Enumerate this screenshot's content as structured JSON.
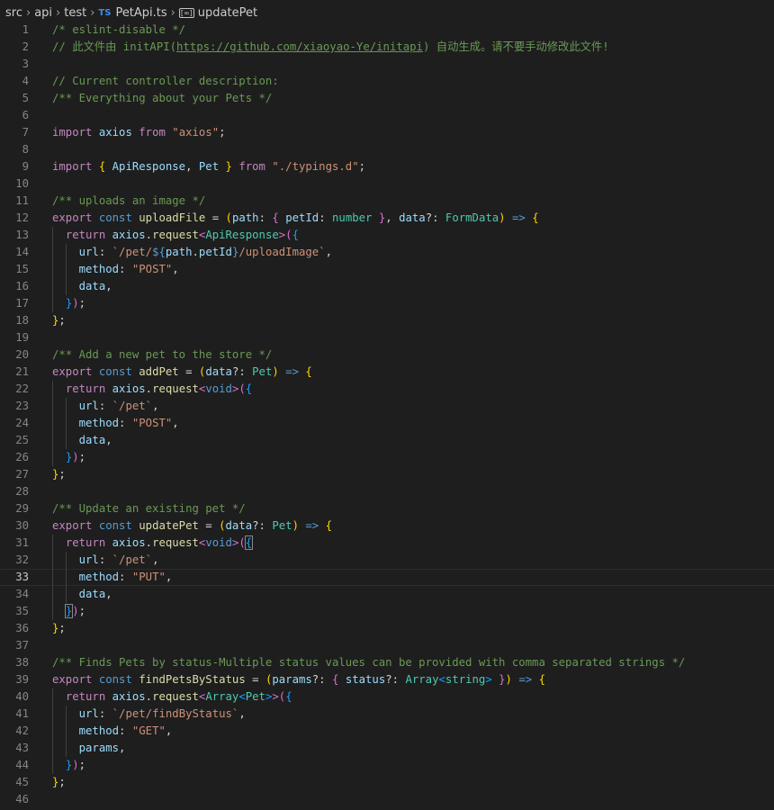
{
  "breadcrumb": {
    "items": [
      "src",
      "api",
      "test"
    ],
    "file_badge": "TS",
    "file": "PetApi.ts",
    "symbol": "updatePet"
  },
  "editor": {
    "active_line": 33,
    "lines": [
      {
        "n": 1,
        "tokens": [
          [
            "c",
            "/* eslint-disable */"
          ]
        ]
      },
      {
        "n": 2,
        "tokens": [
          [
            "c",
            "// 此文件由 initAPI("
          ],
          [
            "c u",
            "https://github.com/xiaoyao-Ye/initapi"
          ],
          [
            "c",
            ") 自动生成。请不要手动修改此文件!"
          ]
        ]
      },
      {
        "n": 3,
        "tokens": []
      },
      {
        "n": 4,
        "tokens": [
          [
            "c",
            "// Current controller description:"
          ]
        ]
      },
      {
        "n": 5,
        "tokens": [
          [
            "c",
            "/** Everything about your Pets */"
          ]
        ]
      },
      {
        "n": 6,
        "tokens": []
      },
      {
        "n": 7,
        "tokens": [
          [
            "kc",
            "import"
          ],
          [
            "p",
            " "
          ],
          [
            "v",
            "axios"
          ],
          [
            "p",
            " "
          ],
          [
            "kc",
            "from"
          ],
          [
            "p",
            " "
          ],
          [
            "s",
            "\"axios\""
          ],
          [
            "p",
            ";"
          ]
        ]
      },
      {
        "n": 8,
        "tokens": []
      },
      {
        "n": 9,
        "tokens": [
          [
            "kc",
            "import"
          ],
          [
            "p",
            " "
          ],
          [
            "b1",
            "{"
          ],
          [
            "p",
            " "
          ],
          [
            "v",
            "ApiResponse"
          ],
          [
            "p",
            ", "
          ],
          [
            "v",
            "Pet"
          ],
          [
            "p",
            " "
          ],
          [
            "b1",
            "}"
          ],
          [
            "p",
            " "
          ],
          [
            "kc",
            "from"
          ],
          [
            "p",
            " "
          ],
          [
            "s",
            "\"./typings.d\""
          ],
          [
            "p",
            ";"
          ]
        ]
      },
      {
        "n": 10,
        "tokens": []
      },
      {
        "n": 11,
        "tokens": [
          [
            "c",
            "/** uploads an image */"
          ]
        ]
      },
      {
        "n": 12,
        "tokens": [
          [
            "kc",
            "export"
          ],
          [
            "p",
            " "
          ],
          [
            "k",
            "const"
          ],
          [
            "p",
            " "
          ],
          [
            "f",
            "uploadFile"
          ],
          [
            "p",
            " = "
          ],
          [
            "b1",
            "("
          ],
          [
            "v",
            "path"
          ],
          [
            "p",
            ": "
          ],
          [
            "b2",
            "{"
          ],
          [
            "p",
            " "
          ],
          [
            "v",
            "petId"
          ],
          [
            "p",
            ": "
          ],
          [
            "t",
            "number"
          ],
          [
            "p",
            " "
          ],
          [
            "b2",
            "}"
          ],
          [
            "p",
            ", "
          ],
          [
            "v",
            "data"
          ],
          [
            "p",
            "?: "
          ],
          [
            "t",
            "FormData"
          ],
          [
            "b1",
            ")"
          ],
          [
            "p",
            " "
          ],
          [
            "k",
            "=>"
          ],
          [
            "p",
            " "
          ],
          [
            "b1",
            "{"
          ]
        ]
      },
      {
        "n": 13,
        "tokens": [
          [
            "p",
            "  "
          ],
          [
            "kc",
            "return"
          ],
          [
            "p",
            " "
          ],
          [
            "v",
            "axios"
          ],
          [
            "p",
            "."
          ],
          [
            "f",
            "request"
          ],
          [
            "b2",
            "<"
          ],
          [
            "t",
            "ApiResponse"
          ],
          [
            "b2",
            ">("
          ],
          [
            "b3",
            "{"
          ]
        ]
      },
      {
        "n": 14,
        "tokens": [
          [
            "p",
            "    "
          ],
          [
            "v",
            "url"
          ],
          [
            "p",
            ": "
          ],
          [
            "s",
            "`/pet/"
          ],
          [
            "k",
            "${"
          ],
          [
            "v",
            "path"
          ],
          [
            "p",
            "."
          ],
          [
            "v",
            "petId"
          ],
          [
            "k",
            "}"
          ],
          [
            "s",
            "/uploadImage`"
          ],
          [
            "p",
            ","
          ]
        ]
      },
      {
        "n": 15,
        "tokens": [
          [
            "p",
            "    "
          ],
          [
            "v",
            "method"
          ],
          [
            "p",
            ": "
          ],
          [
            "s",
            "\"POST\""
          ],
          [
            "p",
            ","
          ]
        ]
      },
      {
        "n": 16,
        "tokens": [
          [
            "p",
            "    "
          ],
          [
            "v",
            "data"
          ],
          [
            "p",
            ","
          ]
        ]
      },
      {
        "n": 17,
        "tokens": [
          [
            "p",
            "  "
          ],
          [
            "b3",
            "}"
          ],
          [
            "b2",
            ")"
          ],
          [
            "p",
            ";"
          ]
        ]
      },
      {
        "n": 18,
        "tokens": [
          [
            "b1",
            "}"
          ],
          [
            "p",
            ";"
          ]
        ]
      },
      {
        "n": 19,
        "tokens": []
      },
      {
        "n": 20,
        "tokens": [
          [
            "c",
            "/** Add a new pet to the store */"
          ]
        ]
      },
      {
        "n": 21,
        "tokens": [
          [
            "kc",
            "export"
          ],
          [
            "p",
            " "
          ],
          [
            "k",
            "const"
          ],
          [
            "p",
            " "
          ],
          [
            "f",
            "addPet"
          ],
          [
            "p",
            " = "
          ],
          [
            "b1",
            "("
          ],
          [
            "v",
            "data"
          ],
          [
            "p",
            "?: "
          ],
          [
            "t",
            "Pet"
          ],
          [
            "b1",
            ")"
          ],
          [
            "p",
            " "
          ],
          [
            "k",
            "=>"
          ],
          [
            "p",
            " "
          ],
          [
            "b1",
            "{"
          ]
        ]
      },
      {
        "n": 22,
        "tokens": [
          [
            "p",
            "  "
          ],
          [
            "kc",
            "return"
          ],
          [
            "p",
            " "
          ],
          [
            "v",
            "axios"
          ],
          [
            "p",
            "."
          ],
          [
            "f",
            "request"
          ],
          [
            "b2",
            "<"
          ],
          [
            "k",
            "void"
          ],
          [
            "b2",
            ">("
          ],
          [
            "b3",
            "{"
          ]
        ]
      },
      {
        "n": 23,
        "tokens": [
          [
            "p",
            "    "
          ],
          [
            "v",
            "url"
          ],
          [
            "p",
            ": "
          ],
          [
            "s",
            "`/pet`"
          ],
          [
            "p",
            ","
          ]
        ]
      },
      {
        "n": 24,
        "tokens": [
          [
            "p",
            "    "
          ],
          [
            "v",
            "method"
          ],
          [
            "p",
            ": "
          ],
          [
            "s",
            "\"POST\""
          ],
          [
            "p",
            ","
          ]
        ]
      },
      {
        "n": 25,
        "tokens": [
          [
            "p",
            "    "
          ],
          [
            "v",
            "data"
          ],
          [
            "p",
            ","
          ]
        ]
      },
      {
        "n": 26,
        "tokens": [
          [
            "p",
            "  "
          ],
          [
            "b3",
            "}"
          ],
          [
            "b2",
            ")"
          ],
          [
            "p",
            ";"
          ]
        ]
      },
      {
        "n": 27,
        "tokens": [
          [
            "b1",
            "}"
          ],
          [
            "p",
            ";"
          ]
        ]
      },
      {
        "n": 28,
        "tokens": []
      },
      {
        "n": 29,
        "tokens": [
          [
            "c",
            "/** Update an existing pet */"
          ]
        ]
      },
      {
        "n": 30,
        "tokens": [
          [
            "kc",
            "export"
          ],
          [
            "p",
            " "
          ],
          [
            "k",
            "const"
          ],
          [
            "p",
            " "
          ],
          [
            "f",
            "updatePet"
          ],
          [
            "p",
            " = "
          ],
          [
            "b1",
            "("
          ],
          [
            "v",
            "data"
          ],
          [
            "p",
            "?: "
          ],
          [
            "t",
            "Pet"
          ],
          [
            "b1",
            ")"
          ],
          [
            "p",
            " "
          ],
          [
            "k",
            "=>"
          ],
          [
            "p",
            " "
          ],
          [
            "b1",
            "{"
          ]
        ]
      },
      {
        "n": 31,
        "tokens": [
          [
            "p",
            "  "
          ],
          [
            "kc",
            "return"
          ],
          [
            "p",
            " "
          ],
          [
            "v",
            "axios"
          ],
          [
            "p",
            "."
          ],
          [
            "f",
            "request"
          ],
          [
            "b2",
            "<"
          ],
          [
            "k",
            "void"
          ],
          [
            "b2",
            ">("
          ],
          [
            "b3 bm",
            "{"
          ]
        ]
      },
      {
        "n": 32,
        "tokens": [
          [
            "p",
            "    "
          ],
          [
            "v",
            "url"
          ],
          [
            "p",
            ": "
          ],
          [
            "s",
            "`/pet`"
          ],
          [
            "p",
            ","
          ]
        ]
      },
      {
        "n": 33,
        "tokens": [
          [
            "p",
            "    "
          ],
          [
            "v",
            "method"
          ],
          [
            "p",
            ": "
          ],
          [
            "s",
            "\"PUT\""
          ],
          [
            "p",
            ","
          ]
        ]
      },
      {
        "n": 34,
        "tokens": [
          [
            "p",
            "    "
          ],
          [
            "v",
            "data"
          ],
          [
            "p",
            ","
          ]
        ]
      },
      {
        "n": 35,
        "tokens": [
          [
            "p",
            "  "
          ],
          [
            "b3 bm",
            "}"
          ],
          [
            "b2",
            ")"
          ],
          [
            "p",
            ";"
          ]
        ]
      },
      {
        "n": 36,
        "tokens": [
          [
            "b1",
            "}"
          ],
          [
            "p",
            ";"
          ]
        ]
      },
      {
        "n": 37,
        "tokens": []
      },
      {
        "n": 38,
        "tokens": [
          [
            "c",
            "/** Finds Pets by status-Multiple status values can be provided with comma separated strings */"
          ]
        ]
      },
      {
        "n": 39,
        "tokens": [
          [
            "kc",
            "export"
          ],
          [
            "p",
            " "
          ],
          [
            "k",
            "const"
          ],
          [
            "p",
            " "
          ],
          [
            "f",
            "findPetsByStatus"
          ],
          [
            "p",
            " = "
          ],
          [
            "b1",
            "("
          ],
          [
            "v",
            "params"
          ],
          [
            "p",
            "?: "
          ],
          [
            "b2",
            "{"
          ],
          [
            "p",
            " "
          ],
          [
            "v",
            "status"
          ],
          [
            "p",
            "?: "
          ],
          [
            "t",
            "Array"
          ],
          [
            "b3",
            "<"
          ],
          [
            "t",
            "string"
          ],
          [
            "b3",
            ">"
          ],
          [
            "p",
            " "
          ],
          [
            "b2",
            "}"
          ],
          [
            "b1",
            ")"
          ],
          [
            "p",
            " "
          ],
          [
            "k",
            "=>"
          ],
          [
            "p",
            " "
          ],
          [
            "b1",
            "{"
          ]
        ]
      },
      {
        "n": 40,
        "tokens": [
          [
            "p",
            "  "
          ],
          [
            "kc",
            "return"
          ],
          [
            "p",
            " "
          ],
          [
            "v",
            "axios"
          ],
          [
            "p",
            "."
          ],
          [
            "f",
            "request"
          ],
          [
            "b2",
            "<"
          ],
          [
            "t",
            "Array"
          ],
          [
            "b3",
            "<"
          ],
          [
            "t",
            "Pet"
          ],
          [
            "b3",
            ">"
          ],
          [
            "b2",
            ">("
          ],
          [
            "b3",
            "{"
          ]
        ]
      },
      {
        "n": 41,
        "tokens": [
          [
            "p",
            "    "
          ],
          [
            "v",
            "url"
          ],
          [
            "p",
            ": "
          ],
          [
            "s",
            "`/pet/findByStatus`"
          ],
          [
            "p",
            ","
          ]
        ]
      },
      {
        "n": 42,
        "tokens": [
          [
            "p",
            "    "
          ],
          [
            "v",
            "method"
          ],
          [
            "p",
            ": "
          ],
          [
            "s",
            "\"GET\""
          ],
          [
            "p",
            ","
          ]
        ]
      },
      {
        "n": 43,
        "tokens": [
          [
            "p",
            "    "
          ],
          [
            "v",
            "params"
          ],
          [
            "p",
            ","
          ]
        ]
      },
      {
        "n": 44,
        "tokens": [
          [
            "p",
            "  "
          ],
          [
            "b3",
            "}"
          ],
          [
            "b2",
            ")"
          ],
          [
            "p",
            ";"
          ]
        ]
      },
      {
        "n": 45,
        "tokens": [
          [
            "b1",
            "}"
          ],
          [
            "p",
            ";"
          ]
        ]
      },
      {
        "n": 46,
        "tokens": []
      }
    ]
  }
}
